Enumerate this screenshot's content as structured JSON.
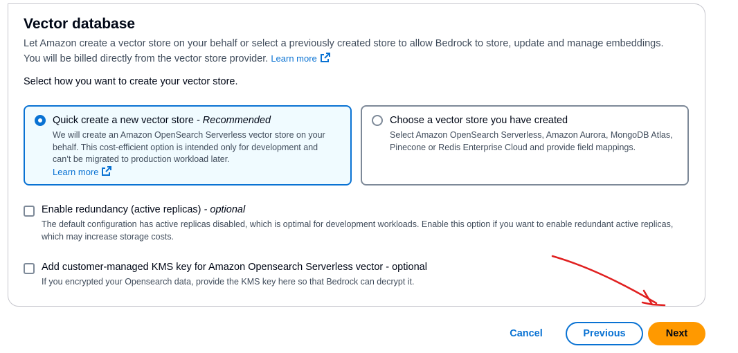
{
  "section": {
    "title": "Vector database",
    "description": "Let Amazon create a vector store on your behalf or select a previously created store to allow Bedrock to store, update and manage embeddings. You will be billed directly from the vector store provider.",
    "learn_more": "Learn more",
    "prompt": "Select how you want to create your vector store."
  },
  "options": [
    {
      "title": "Quick create a new vector store",
      "title_suffix": " - Recommended",
      "description": "We will create an Amazon OpenSearch Serverless vector store on your behalf. This cost-efficient option is intended only for development and can’t be migrated to production workload later.",
      "learn_more": "Learn more",
      "selected": true
    },
    {
      "title": "Choose a vector store you have created",
      "description": "Select Amazon OpenSearch Serverless, Amazon Aurora, MongoDB Atlas, Pinecone or Redis Enterprise Cloud and provide field mappings.",
      "selected": false
    }
  ],
  "checkboxes": [
    {
      "label": "Enable redundancy (active replicas)",
      "suffix": " - optional",
      "description": "The default configuration has active replicas disabled, which is optimal for development workloads. Enable this option if you want to enable redundant active replicas, which may increase storage costs.",
      "checked": false
    },
    {
      "label": "Add customer-managed KMS key for Amazon Opensearch Serverless vector",
      "suffix": " - optional",
      "description": "If you encrypted your Opensearch data, provide the KMS key here so that Bedrock can decrypt it.",
      "checked": false
    }
  ],
  "footer": {
    "cancel": "Cancel",
    "previous": "Previous",
    "next": "Next"
  },
  "colors": {
    "accent": "#0972d3",
    "primary_button": "#ff9900",
    "annotation": "#e02020"
  },
  "icons": [
    "external-link-icon",
    "radio-icon",
    "checkbox-icon",
    "arrow-annotation-icon"
  ]
}
